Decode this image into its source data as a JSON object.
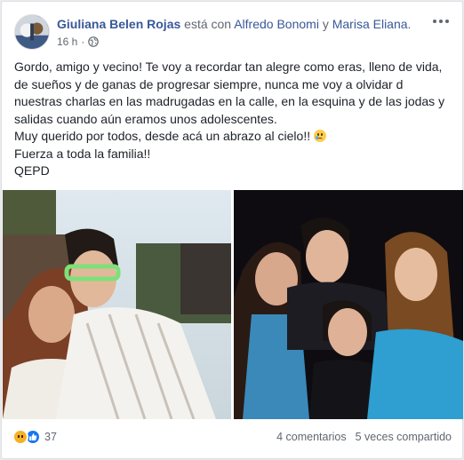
{
  "post": {
    "author": "Giuliana Belen Rojas",
    "with_text": "está con",
    "tagged_1": "Alfredo Bonomi",
    "conjunction": "y",
    "tagged_2": "Marisa Eliana",
    "period": ".",
    "time": "16 h",
    "separator": "·",
    "privacy_icon": "globe-icon",
    "more_icon": "ellipsis-icon",
    "paragraphs": [
      "Gordo, amigo y vecino! Te voy a recordar tan alegre como eras, lleno de vida, de sueños y de ganas de progresar siempre, nunca me voy a olvidar d nuestras charlas en las madrugadas en la calle, en la esquina y de las jodas y salidas cuando aún eramos unos adolescentes.",
      "Muy querido por todos, desde acá un abrazo al cielo!! ",
      "Fuerza a toda la familia!!"
    ],
    "closing": "QEPD",
    "photos": [
      "photo-left",
      "photo-right"
    ]
  },
  "footer": {
    "reaction_icons": [
      "sad-reaction-icon",
      "like-reaction-icon"
    ],
    "reaction_count": "37",
    "comments": "4 comentarios",
    "shares": "5 veces compartido"
  },
  "colors": {
    "link": "#385898",
    "text": "#1d2129",
    "secondary": "#616770",
    "like": "#1877f2",
    "sad": "#f7b125"
  }
}
